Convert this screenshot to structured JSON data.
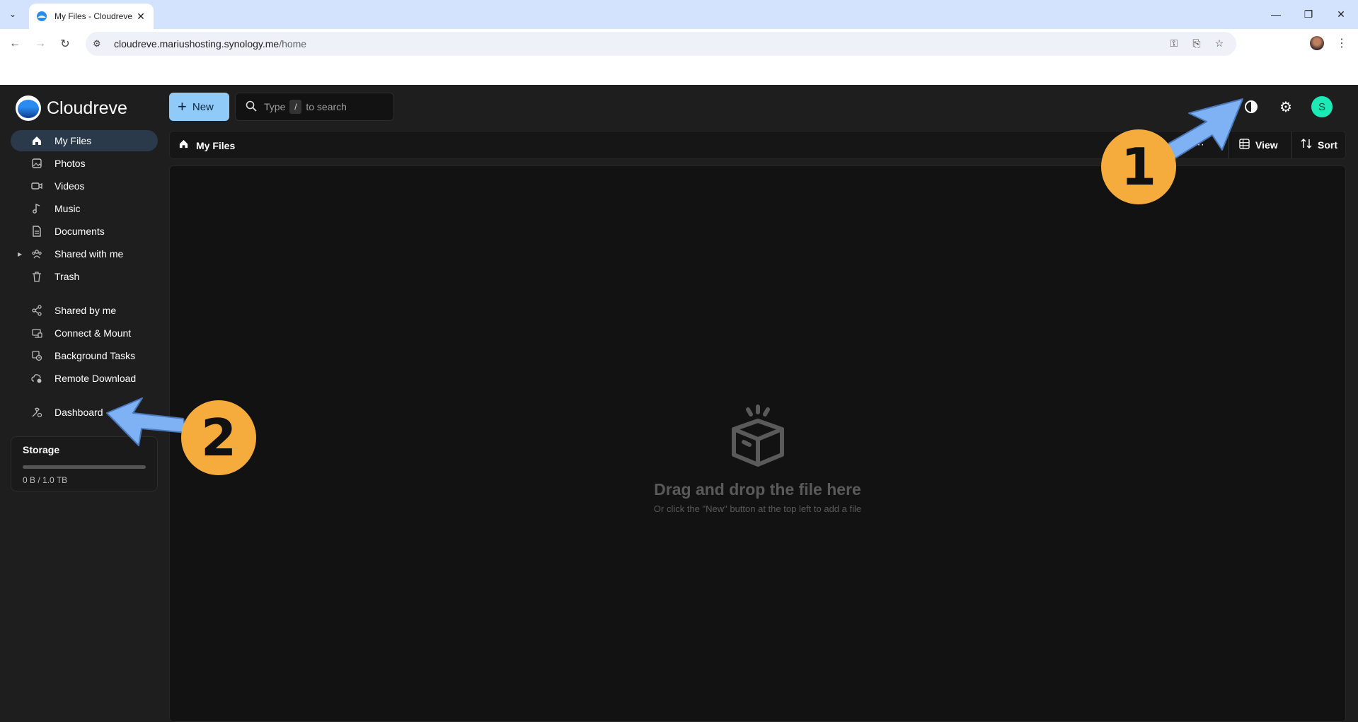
{
  "browser": {
    "tab_title": "My Files - Cloudreve",
    "url_host": "cloudreve.mariushosting.synology.me",
    "url_path": "/home"
  },
  "app": {
    "name": "Cloudreve",
    "new_label": "New",
    "search_prefix": "Type",
    "search_key": "/",
    "search_suffix": "to search",
    "avatar_letter": "S"
  },
  "sidebar": {
    "items": [
      {
        "label": "My Files",
        "icon": "home-icon"
      },
      {
        "label": "Photos",
        "icon": "image-icon"
      },
      {
        "label": "Videos",
        "icon": "video-icon"
      },
      {
        "label": "Music",
        "icon": "music-icon"
      },
      {
        "label": "Documents",
        "icon": "document-icon"
      },
      {
        "label": "Shared with me",
        "icon": "people-icon"
      },
      {
        "label": "Trash",
        "icon": "trash-icon"
      },
      {
        "label": "Shared by me",
        "icon": "share-icon"
      },
      {
        "label": "Connect & Mount",
        "icon": "connect-icon"
      },
      {
        "label": "Background Tasks",
        "icon": "tasks-icon"
      },
      {
        "label": "Remote Download",
        "icon": "cloud-download-icon"
      },
      {
        "label": "Dashboard",
        "icon": "dashboard-icon"
      }
    ]
  },
  "storage": {
    "title": "Storage",
    "usage_text": "0 B / 1.0 TB",
    "used_fraction": 0
  },
  "main": {
    "breadcrumb": "My Files",
    "view_label": "View",
    "sort_label": "Sort",
    "empty_title": "Drag and drop the file here",
    "empty_subtitle": "Or click the \"New\" button at the top left to add a file"
  },
  "annotations": {
    "callout_1": "1",
    "callout_2": "2",
    "accent": "#f6ac3c",
    "arrow_color": "#7fb2f5"
  }
}
